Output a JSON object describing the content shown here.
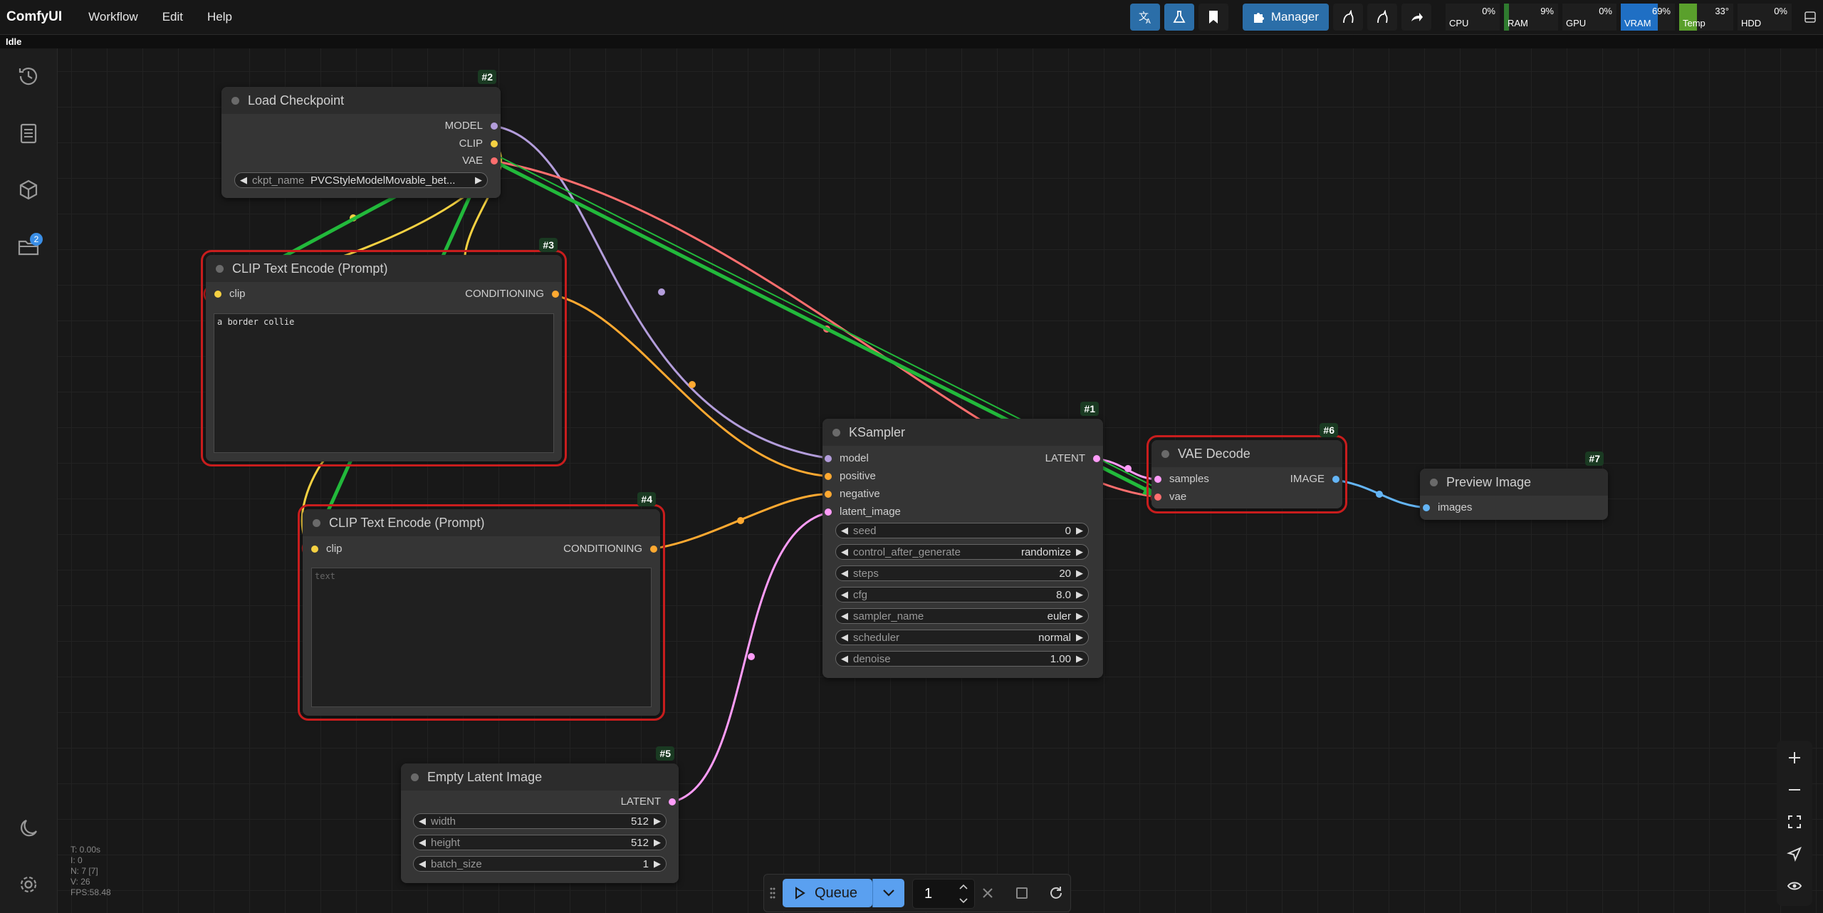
{
  "app": {
    "title": "ComfyUI",
    "menu": [
      "Workflow",
      "Edit",
      "Help"
    ],
    "status": "Idle"
  },
  "toolbar": {
    "manager_label": "Manager",
    "monitors": [
      {
        "label": "CPU",
        "value": "0%",
        "level": 0,
        "color": "#2f7a2f"
      },
      {
        "label": "RAM",
        "value": "9%",
        "level": 9,
        "color": "#2f7a2f"
      },
      {
        "label": "GPU",
        "value": "0%",
        "level": 0,
        "color": "#2f7a2f"
      },
      {
        "label": "VRAM",
        "value": "69%",
        "level": 69,
        "color": "#1f6fc4"
      },
      {
        "label": "Temp",
        "value": "33°",
        "level": 33,
        "color": "#5aa02c"
      },
      {
        "label": "HDD",
        "value": "0%",
        "level": 0,
        "color": "#2f7a2f"
      }
    ]
  },
  "sidebar": {
    "items": [
      "history-icon",
      "document-icon",
      "cube-icon",
      "folder-icon"
    ],
    "folder_badge": "2",
    "bottom": [
      "moon-icon",
      "gear-icon"
    ]
  },
  "nodes": {
    "load_checkpoint": {
      "id": "#2",
      "title": "Load Checkpoint",
      "outputs": [
        "MODEL",
        "CLIP",
        "VAE"
      ],
      "ckpt_label": "ckpt_name",
      "ckpt_value": "PVCStyleModelMovable_bet..."
    },
    "clip_pos": {
      "id": "#3",
      "title": "CLIP Text Encode (Prompt)",
      "input": "clip",
      "output": "CONDITIONING",
      "text": "a border collie"
    },
    "clip_neg": {
      "id": "#4",
      "title": "CLIP Text Encode (Prompt)",
      "input": "clip",
      "output": "CONDITIONING",
      "placeholder": "text"
    },
    "empty_latent": {
      "id": "#5",
      "title": "Empty Latent Image",
      "output": "LATENT",
      "widgets": [
        {
          "name": "width",
          "value": "512"
        },
        {
          "name": "height",
          "value": "512"
        },
        {
          "name": "batch_size",
          "value": "1"
        }
      ]
    },
    "ksampler": {
      "id": "#1",
      "title": "KSampler",
      "inputs": [
        "model",
        "positive",
        "negative",
        "latent_image"
      ],
      "output": "LATENT",
      "widgets": [
        {
          "name": "seed",
          "value": "0"
        },
        {
          "name": "control_after_generate",
          "value": "randomize"
        },
        {
          "name": "steps",
          "value": "20"
        },
        {
          "name": "cfg",
          "value": "8.0"
        },
        {
          "name": "sampler_name",
          "value": "euler"
        },
        {
          "name": "scheduler",
          "value": "normal"
        },
        {
          "name": "denoise",
          "value": "1.00"
        }
      ]
    },
    "vae_decode": {
      "id": "#6",
      "title": "VAE Decode",
      "inputs": [
        "samples",
        "vae"
      ],
      "output": "IMAGE"
    },
    "preview": {
      "id": "#7",
      "title": "Preview Image",
      "input": "images"
    }
  },
  "colors": {
    "model": "#b39ddb",
    "clip": "#f5d142",
    "vae": "#ff6e6e",
    "conditioning": "#ffa931",
    "latent": "#ff9cf9",
    "image": "#64b5f6",
    "drag_link": "#22b93b",
    "selection": "#c81d1d"
  },
  "stats": [
    "T: 0.00s",
    "I: 0",
    "N: 7 [7]",
    "V: 26",
    "FPS:58.48"
  ],
  "queue": {
    "label": "Queue",
    "count": "1"
  }
}
